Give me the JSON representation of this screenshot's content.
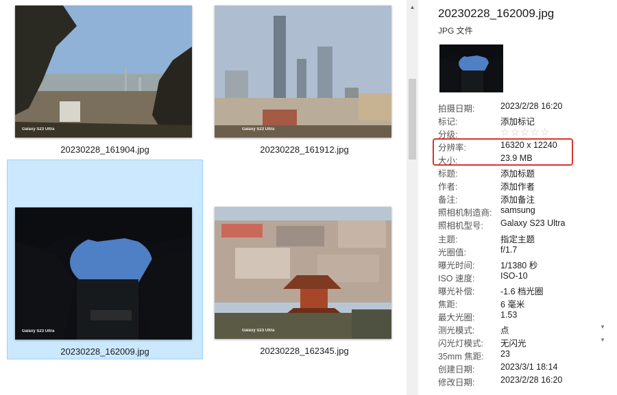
{
  "files": [
    {
      "name": "20230228_161904.jpg",
      "watermark": "Galaxy S23 Ultra",
      "selected": false
    },
    {
      "name": "20230228_161912.jpg",
      "watermark": "Galaxy S23 Ultra",
      "selected": false
    },
    {
      "name": "20230228_162009.jpg",
      "watermark": "Galaxy S23 Ultra",
      "selected": true
    },
    {
      "name": "20230228_162345.jpg",
      "watermark": "Galaxy S23 Ultra",
      "selected": false
    }
  ],
  "details": {
    "title": "20230228_162009.jpg",
    "type": "JPG 文件",
    "properties": [
      {
        "key": "拍摄日期:",
        "value": "2023/2/28 16:20"
      },
      {
        "key": "标记:",
        "value": "添加标记"
      },
      {
        "key": "分级:",
        "value": "",
        "rating": 0,
        "max_rating": 5
      },
      {
        "key": "分辨率:",
        "value": "16320 x 12240"
      },
      {
        "key": "大小:",
        "value": "23.9 MB"
      },
      {
        "key": "标题:",
        "value": "添加标题"
      },
      {
        "key": "作者:",
        "value": "添加作者"
      },
      {
        "key": "备注:",
        "value": "添加备注"
      },
      {
        "key": "照相机制造商:",
        "value": "samsung"
      },
      {
        "key": "照相机型号:",
        "value": "Galaxy S23 Ultra"
      },
      {
        "key": "主题:",
        "value": "指定主题"
      },
      {
        "key": "光圈值:",
        "value": "f/1.7"
      },
      {
        "key": "曝光时间:",
        "value": "1/1380 秒"
      },
      {
        "key": "ISO 速度:",
        "value": "ISO-10"
      },
      {
        "key": "曝光补偿:",
        "value": "-1.6 档光圈"
      },
      {
        "key": "焦距:",
        "value": "6 毫米"
      },
      {
        "key": "最大光圈:",
        "value": "1.53"
      },
      {
        "key": "测光模式:",
        "value": "点",
        "dropdown": true
      },
      {
        "key": "闪光灯模式:",
        "value": "无闪光",
        "dropdown": true
      },
      {
        "key": "35mm 焦距:",
        "value": "23"
      },
      {
        "key": "创建日期:",
        "value": "2023/3/1 18:14"
      },
      {
        "key": "修改日期:",
        "value": "2023/2/28 16:20"
      }
    ]
  },
  "icons": {
    "star": "star-icon",
    "scroll_up": "scroll-up-arrow-icon",
    "dropdown": "chevron-down-icon"
  },
  "colors": {
    "selection": "#cce8ff",
    "selection_border": "#99d1ff",
    "highlight_box": "#d9342b"
  }
}
